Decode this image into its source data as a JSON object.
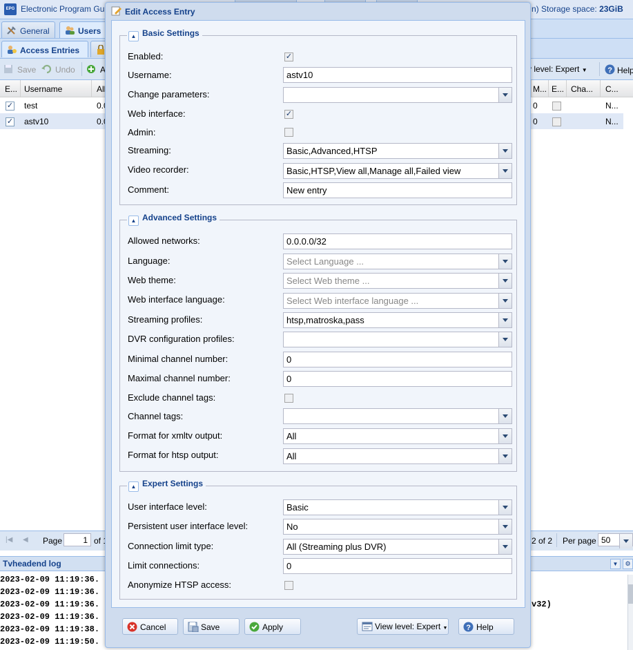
{
  "app": {
    "title": "Electronic Program Gu",
    "storage_label": "n)   Storage space:",
    "storage_value": "23GiB"
  },
  "main_tabs": [
    {
      "label": "General"
    },
    {
      "label": "Users"
    }
  ],
  "sub_tabs": [
    {
      "label": "Access Entries"
    }
  ],
  "toolbar": {
    "save": "Save",
    "undo": "Undo",
    "add": "A",
    "view_level": "v level: Expert",
    "help": "Help"
  },
  "grid": {
    "columns": [
      "E...",
      "Username",
      "All",
      "M...",
      "E...",
      "Cha...",
      "C..."
    ],
    "rows": [
      {
        "enabled": true,
        "username": "test",
        "networks": "0.0",
        "m": "0",
        "c": "N..."
      },
      {
        "enabled": true,
        "username": "astv10",
        "networks": "0.0",
        "m": "0",
        "c": "N..."
      }
    ]
  },
  "pager": {
    "page_label": "Page",
    "page_value": "1",
    "of_label": "of 1",
    "display": "2 of 2",
    "per_page_label": "Per page",
    "per_page_value": "50"
  },
  "log": {
    "title": "Tvheadend log",
    "lines": [
      "2023-02-09 11:19:36.",
      "2023-02-09 11:19:36.",
      "2023-02-09 11:19:36.",
      "2023-02-09 11:19:36.",
      "2023-02-09 11:19:38.",
      "2023-02-09 11:19:50."
    ],
    "tail": "v32)"
  },
  "dialog": {
    "title": "Edit Access Entry",
    "sections": {
      "basic": "Basic Settings",
      "advanced": "Advanced Settings",
      "expert": "Expert Settings"
    },
    "fields": {
      "enabled": {
        "label": "Enabled:",
        "checked": true
      },
      "username": {
        "label": "Username:",
        "value": "astv10"
      },
      "change_parameters": {
        "label": "Change parameters:",
        "value": ""
      },
      "web_interface": {
        "label": "Web interface:",
        "checked": true
      },
      "admin": {
        "label": "Admin:",
        "checked": false
      },
      "streaming": {
        "label": "Streaming:",
        "value": "Basic,Advanced,HTSP"
      },
      "video_recorder": {
        "label": "Video recorder:",
        "value": "Basic,HTSP,View all,Manage all,Failed view"
      },
      "comment": {
        "label": "Comment:",
        "value": "New entry"
      },
      "allowed_networks": {
        "label": "Allowed networks:",
        "value": "0.0.0.0/32"
      },
      "language": {
        "label": "Language:",
        "placeholder": "Select Language ..."
      },
      "web_theme": {
        "label": "Web theme:",
        "placeholder": "Select Web theme ..."
      },
      "web_ui_language": {
        "label": "Web interface language:",
        "placeholder": "Select Web interface language ..."
      },
      "streaming_profiles": {
        "label": "Streaming profiles:",
        "value": "htsp,matroska,pass"
      },
      "dvr_profiles": {
        "label": "DVR configuration profiles:",
        "value": ""
      },
      "min_channel": {
        "label": "Minimal channel number:",
        "value": "0"
      },
      "max_channel": {
        "label": "Maximal channel number:",
        "value": "0"
      },
      "exclude_tags": {
        "label": "Exclude channel tags:",
        "checked": false
      },
      "channel_tags": {
        "label": "Channel tags:",
        "value": ""
      },
      "xmltv_format": {
        "label": "Format for xmltv output:",
        "value": "All"
      },
      "htsp_format": {
        "label": "Format for htsp output:",
        "value": "All"
      },
      "ui_level": {
        "label": "User interface level:",
        "value": "Basic"
      },
      "persistent_ui_level": {
        "label": "Persistent user interface level:",
        "value": "No"
      },
      "conn_limit_type": {
        "label": "Connection limit type:",
        "value": "All (Streaming plus DVR)"
      },
      "limit_connections": {
        "label": "Limit connections:",
        "value": "0"
      },
      "anonymize_htsp": {
        "label": "Anonymize HTSP access:",
        "checked": false
      }
    },
    "buttons": {
      "cancel": "Cancel",
      "save": "Save",
      "apply": "Apply",
      "view_level": "View level: Expert",
      "help": "Help"
    }
  },
  "colors": {
    "title_text": "#15428b",
    "header_bg": "#dfe8f6",
    "border": "#99bbe8"
  }
}
